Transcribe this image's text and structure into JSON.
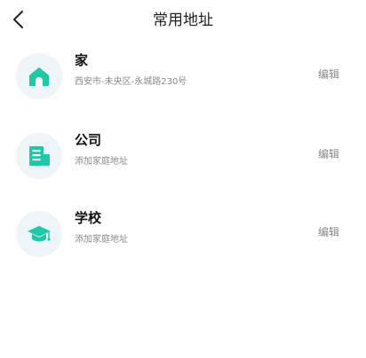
{
  "header": {
    "title": "常用地址",
    "back_icon": "chevron-left-icon"
  },
  "colors": {
    "accent": "#1ec8a8",
    "icon_bg": "#eef5f8"
  },
  "addresses": [
    {
      "icon": "home-icon",
      "title": "家",
      "subtitle": "西安市-未央区-永城路230号",
      "edit_label": "编辑"
    },
    {
      "icon": "building-icon",
      "title": "公司",
      "subtitle": "添加家庭地址",
      "edit_label": "编辑"
    },
    {
      "icon": "graduation-cap-icon",
      "title": "学校",
      "subtitle": "添加家庭地址",
      "edit_label": "编辑"
    }
  ]
}
